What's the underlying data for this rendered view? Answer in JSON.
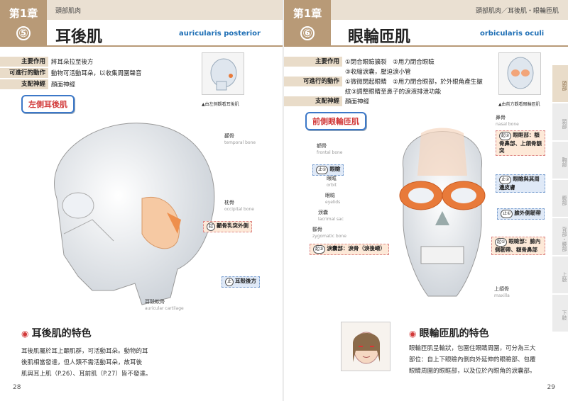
{
  "left": {
    "chapter": "第1章",
    "number": "⑤",
    "crumb": "頭部肌肉",
    "title_jp": "耳後肌",
    "title_en": "auricularis posterior",
    "info": [
      {
        "label": "主要作用",
        "value": "將耳朵拉至後方"
      },
      {
        "label": "可進行的動作",
        "value": "動物可活動耳朵，以收集周圍聲音"
      },
      {
        "label": "支配神經",
        "value": "顏面神經"
      }
    ],
    "thumb_caption": "▲由左側觀看耳後肌",
    "side_tag": "左側耳後肌",
    "labels": {
      "temporal_jp": "顳骨",
      "temporal_en": "temporal bone",
      "occipital_jp": "枕骨",
      "occipital_en": "occipital bone",
      "cartilage_jp": "耳殼軟骨",
      "cartilage_en": "auricular cartilage"
    },
    "callout_origin_pin": "起",
    "callout_origin": "顳骨乳突外側",
    "callout_insert_pin": "止",
    "callout_insert": "耳殼後方",
    "feature_title": "耳後肌的特色",
    "feature_lines": [
      "耳後肌屬於耳上顳肌群，可活動耳朵。動物的耳",
      "後肌相當發達，但人類不需活動耳朵，故耳後",
      "肌與耳上肌（P.26）、耳前肌（P.27）皆不發達。"
    ],
    "page_number": "28"
  },
  "right": {
    "chapter": "第1章",
    "number": "⑥",
    "crumb": "頭部肌肉／耳後肌・眼輪匝肌",
    "title_jp": "眼輪匝肌",
    "title_en": "orbicularis oculi",
    "info": [
      {
        "label": "主要作用",
        "value": "①閉合眼瞼擴裂　②用力閉合眼瞼"
      },
      {
        "label": "",
        "value": "③收縮淚囊，壓迫淚小管"
      },
      {
        "label": "可進行的動作",
        "value": "①微微閉起眼睛　②用力閉合眼部，於外眼角產生皺"
      },
      {
        "label": "",
        "value": "紋③調整眼睛至鼻子的淚液排泄功能"
      },
      {
        "label": "支配神經",
        "value": "顏面神經"
      }
    ],
    "thumb_caption": "▲由前方觀看眼輪匝肌",
    "side_tag": "前側眼輪匝肌",
    "labels": {
      "nasal_jp": "鼻骨",
      "nasal_en": "nasal bone",
      "frontal_jp": "額骨",
      "frontal_en": "frontal bone",
      "orbit_jp": "眼眶",
      "orbit_en": "orbit",
      "eyelid_jp": "眼瞼",
      "eyelid_en": "eyelids",
      "lacrimal_jp": "淚囊",
      "lacrimal_en": "lacrimal sac",
      "zygomatic_jp": "顴骨",
      "zygomatic_en": "zygomatic bone",
      "maxilla_jp": "上頜骨",
      "maxilla_en": "maxilla"
    },
    "callouts": [
      {
        "pin": "起②",
        "text": "眼眶部：額骨鼻部、上頜骨額突"
      },
      {
        "pin": "止①",
        "text": "眼瞼"
      },
      {
        "pin": "止②",
        "text": "眼瞼與其周邊皮膚"
      },
      {
        "pin": "止①",
        "text": "臉外側韌帶"
      },
      {
        "pin": "起①",
        "text": "眼瞼部：臉內側韌帶、額骨鼻部"
      },
      {
        "pin": "起③",
        "text": "淚囊部：淚骨（淚後嵴）"
      }
    ],
    "feature_title": "眼輪匝肌的特色",
    "feature_lines": [
      "眼輪匝肌呈輪狀，包圍住眼睛周圍，可分為三大",
      "部位：自上下眼瞼內側向外延伸的眼瞼部、包覆",
      "眼睛周圍的眼眶部，以及位於內眼角的淚囊部。"
    ],
    "side_tabs": [
      "頭部",
      "頸部",
      "胸部",
      "腹部",
      "背部・腰部",
      "上肢",
      "下肢"
    ],
    "page_number": "29"
  }
}
